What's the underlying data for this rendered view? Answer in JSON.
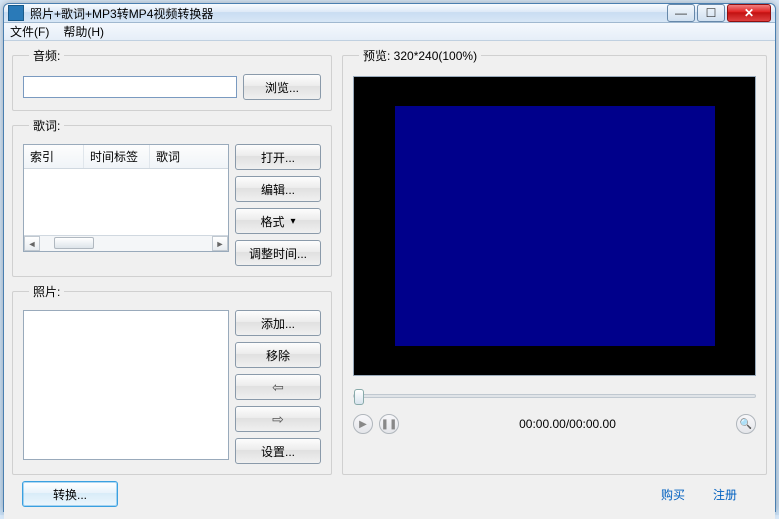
{
  "window": {
    "title": "照片+歌词+MP3转MP4视频转换器"
  },
  "menu": {
    "file": "文件(F)",
    "help": "帮助(H)"
  },
  "audio": {
    "legend": "音频:",
    "value": "",
    "browse": "浏览..."
  },
  "lyrics": {
    "legend": "歌词:",
    "cols": {
      "index": "索引",
      "timetag": "时间标签",
      "lyric": "歌词"
    },
    "open": "打开...",
    "edit": "编辑...",
    "format": "格式",
    "adjust": "调整时间..."
  },
  "photos": {
    "legend": "照片:",
    "add": "添加...",
    "remove": "移除",
    "up": "⇦",
    "down": "⇨",
    "settings": "设置..."
  },
  "preview": {
    "legend": "预览: 320*240(100%)",
    "time": "00:00.00/00:00.00"
  },
  "bottom": {
    "convert": "转换...",
    "buy": "购买",
    "register": "注册"
  }
}
